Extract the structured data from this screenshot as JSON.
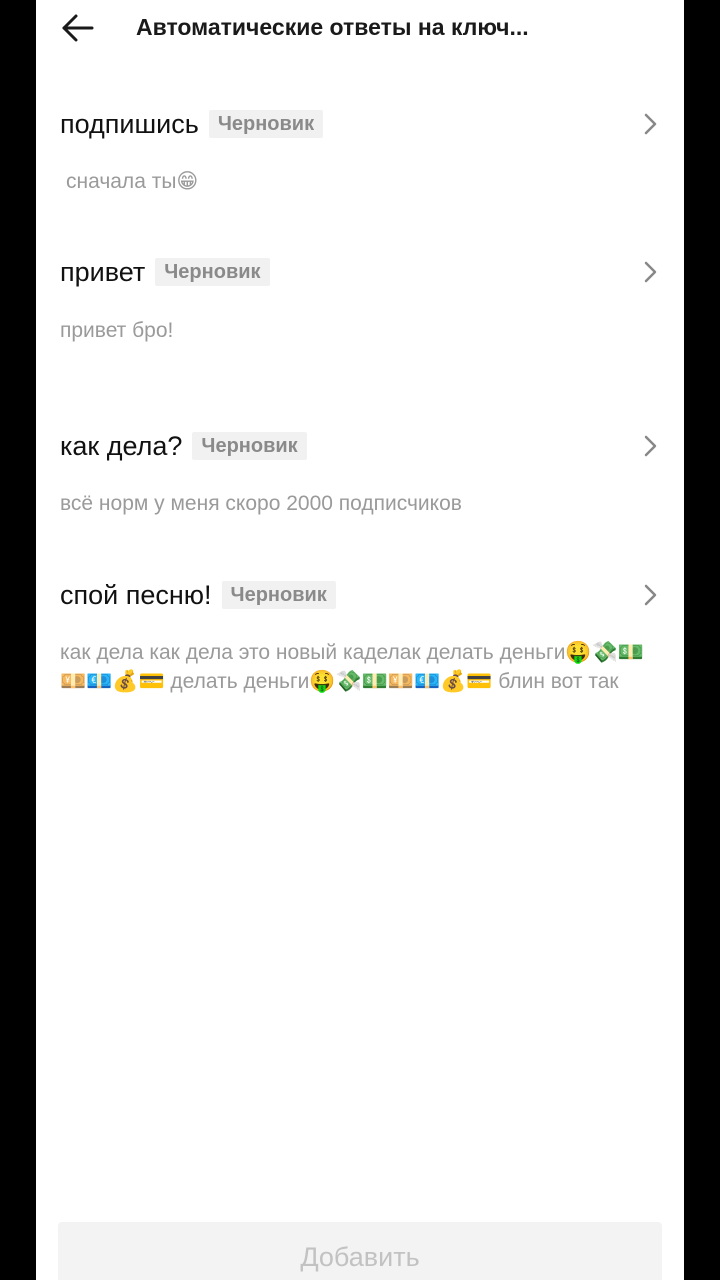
{
  "header": {
    "title": "Автоматические ответы на ключ..."
  },
  "items": [
    {
      "keyword": "подпишись",
      "badge": "Черновик",
      "reply": "сначала ты😁"
    },
    {
      "keyword": "привет",
      "badge": "Черновик",
      "reply": "привет бро!"
    },
    {
      "keyword": "как дела?",
      "badge": "Черновик",
      "reply": "всё норм у меня скоро 2000 подписчиков"
    },
    {
      "keyword": "спой песню!",
      "badge": "Черновик",
      "reply": "как дела как дела это новый каделак делать деньги🤑💸💵💴💶💰💳 делать деньги🤑💸💵💴💶💰💳 блин  вот так"
    }
  ],
  "footer": {
    "add_label": "Добавить"
  },
  "icons": {
    "back": "arrow-left-icon",
    "chevron": "chevron-right-icon"
  }
}
